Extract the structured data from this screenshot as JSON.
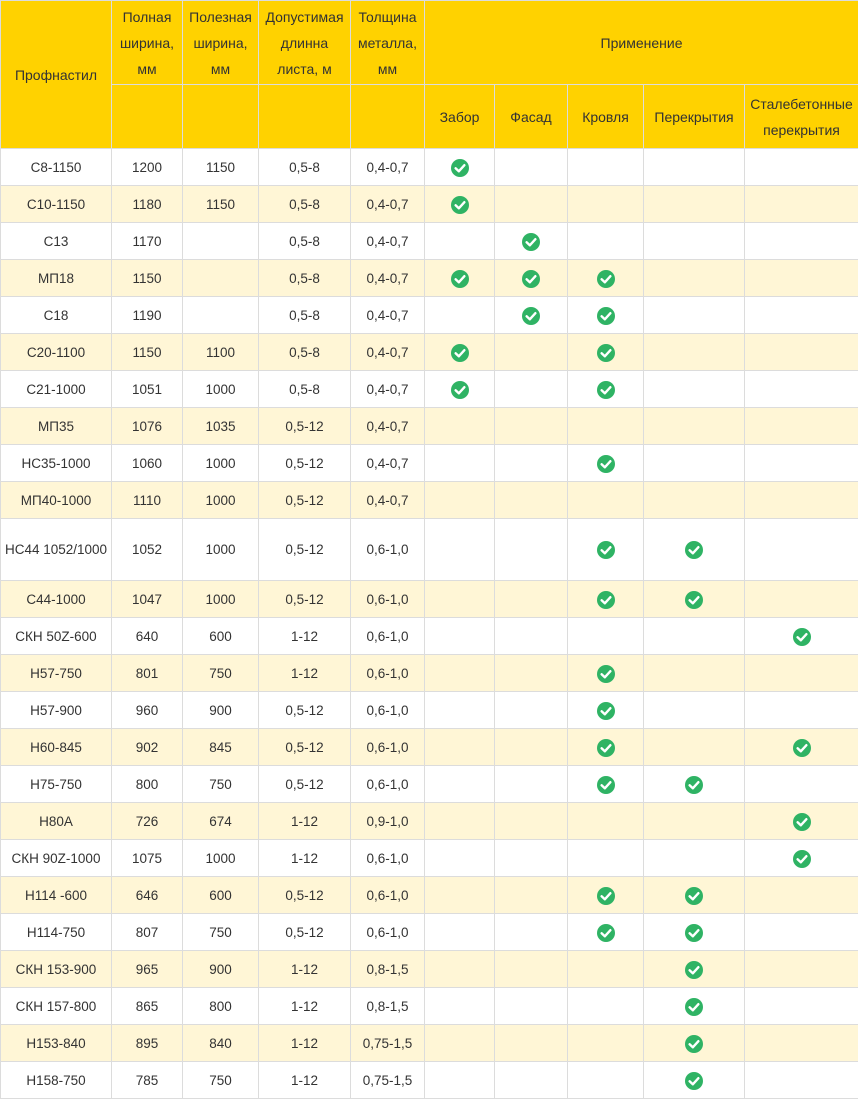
{
  "headers": {
    "profile": "Профнастил",
    "full_width": "Полная ширина, мм",
    "useful_width": "Полезная ширина, мм",
    "length": "Допустимая длинна листа, м",
    "thickness": "Толщина металла, мм",
    "application": "Применение",
    "uses": [
      "Забор",
      "Фасад",
      "Кровля",
      "Перекрытия",
      "Сталебетонные перекрытия"
    ]
  },
  "check_icon": "check-circle-icon",
  "colors": {
    "header_bg": "#ffd200",
    "stripe_bg": "#fff6d6",
    "check": "#2fb364",
    "border": "#dcdcdc"
  },
  "rows": [
    {
      "name": "С8-1150",
      "full": "1200",
      "useful": "1150",
      "length": "0,5-8",
      "thickness": "0,4-0,7",
      "uses": [
        true,
        false,
        false,
        false,
        false
      ]
    },
    {
      "name": "С10-1150",
      "full": "1180",
      "useful": "1150",
      "length": "0,5-8",
      "thickness": "0,4-0,7",
      "uses": [
        true,
        false,
        false,
        false,
        false
      ]
    },
    {
      "name": "С13",
      "full": "1170",
      "useful": "",
      "length": "0,5-8",
      "thickness": "0,4-0,7",
      "uses": [
        false,
        true,
        false,
        false,
        false
      ]
    },
    {
      "name": "МП18",
      "full": "1150",
      "useful": "",
      "length": "0,5-8",
      "thickness": "0,4-0,7",
      "uses": [
        true,
        true,
        true,
        false,
        false
      ]
    },
    {
      "name": "С18",
      "full": "1190",
      "useful": "",
      "length": "0,5-8",
      "thickness": "0,4-0,7",
      "uses": [
        false,
        true,
        true,
        false,
        false
      ]
    },
    {
      "name": "С20-1100",
      "full": "1150",
      "useful": "1100",
      "length": "0,5-8",
      "thickness": "0,4-0,7",
      "uses": [
        true,
        false,
        true,
        false,
        false
      ]
    },
    {
      "name": "С21-1000",
      "full": "1051",
      "useful": "1000",
      "length": "0,5-8",
      "thickness": "0,4-0,7",
      "uses": [
        true,
        false,
        true,
        false,
        false
      ]
    },
    {
      "name": "МП35",
      "full": "1076",
      "useful": "1035",
      "length": "0,5-12",
      "thickness": "0,4-0,7",
      "uses": [
        false,
        false,
        false,
        false,
        false
      ]
    },
    {
      "name": "НС35-1000",
      "full": "1060",
      "useful": "1000",
      "length": "0,5-12",
      "thickness": "0,4-0,7",
      "uses": [
        false,
        false,
        true,
        false,
        false
      ]
    },
    {
      "name": "МП40-1000",
      "full": "1110",
      "useful": "1000",
      "length": "0,5-12",
      "thickness": "0,4-0,7",
      "uses": [
        false,
        false,
        false,
        false,
        false
      ]
    },
    {
      "name": "НС44 1052/1000",
      "full": "1052",
      "useful": "1000",
      "length": "0,5-12",
      "thickness": "0,6-1,0",
      "uses": [
        false,
        false,
        true,
        true,
        false
      ]
    },
    {
      "name": "С44-1000",
      "full": "1047",
      "useful": "1000",
      "length": "0,5-12",
      "thickness": "0,6-1,0",
      "uses": [
        false,
        false,
        true,
        true,
        false
      ]
    },
    {
      "name": "СКН 50Z-600",
      "full": "640",
      "useful": "600",
      "length": "1-12",
      "thickness": "0,6-1,0",
      "uses": [
        false,
        false,
        false,
        false,
        true
      ]
    },
    {
      "name": "Н57-750",
      "full": "801",
      "useful": "750",
      "length": "1-12",
      "thickness": "0,6-1,0",
      "uses": [
        false,
        false,
        true,
        false,
        false
      ]
    },
    {
      "name": "Н57-900",
      "full": "960",
      "useful": "900",
      "length": "0,5-12",
      "thickness": "0,6-1,0",
      "uses": [
        false,
        false,
        true,
        false,
        false
      ]
    },
    {
      "name": "Н60-845",
      "full": "902",
      "useful": "845",
      "length": "0,5-12",
      "thickness": "0,6-1,0",
      "uses": [
        false,
        false,
        true,
        false,
        true
      ]
    },
    {
      "name": "Н75-750",
      "full": "800",
      "useful": "750",
      "length": "0,5-12",
      "thickness": "0,6-1,0",
      "uses": [
        false,
        false,
        true,
        true,
        false
      ]
    },
    {
      "name": "Н80А",
      "full": "726",
      "useful": "674",
      "length": "1-12",
      "thickness": "0,9-1,0",
      "uses": [
        false,
        false,
        false,
        false,
        true
      ]
    },
    {
      "name": "СКН 90Z-1000",
      "full": "1075",
      "useful": "1000",
      "length": "1-12",
      "thickness": "0,6-1,0",
      "uses": [
        false,
        false,
        false,
        false,
        true
      ]
    },
    {
      "name": "Н114 -600",
      "full": "646",
      "useful": "600",
      "length": "0,5-12",
      "thickness": "0,6-1,0",
      "uses": [
        false,
        false,
        true,
        true,
        false
      ]
    },
    {
      "name": "Н114-750",
      "full": "807",
      "useful": "750",
      "length": "0,5-12",
      "thickness": "0,6-1,0",
      "uses": [
        false,
        false,
        true,
        true,
        false
      ]
    },
    {
      "name": "СКН 153-900",
      "full": "965",
      "useful": "900",
      "length": "1-12",
      "thickness": "0,8-1,5",
      "uses": [
        false,
        false,
        false,
        true,
        false
      ]
    },
    {
      "name": "СКН 157-800",
      "full": "865",
      "useful": "800",
      "length": "1-12",
      "thickness": "0,8-1,5",
      "uses": [
        false,
        false,
        false,
        true,
        false
      ]
    },
    {
      "name": "Н153-840",
      "full": "895",
      "useful": "840",
      "length": "1-12",
      "thickness": "0,75-1,5",
      "uses": [
        false,
        false,
        false,
        true,
        false
      ]
    },
    {
      "name": "Н158-750",
      "full": "785",
      "useful": "750",
      "length": "1-12",
      "thickness": "0,75-1,5",
      "uses": [
        false,
        false,
        false,
        true,
        false
      ]
    }
  ]
}
